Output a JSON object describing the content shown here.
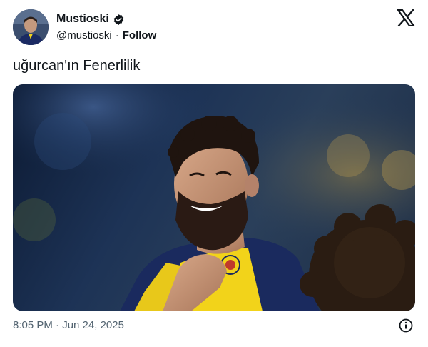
{
  "author": {
    "display_name": "Mustioski",
    "handle": "@mustioski",
    "separator": "·",
    "follow_label": "Follow"
  },
  "tweet": {
    "text": "uğurcan'ın Fenerlilik",
    "timestamp": "8:05 PM · Jun 24, 2025"
  },
  "icons": {
    "verified": "verified-badge-icon",
    "platform": "x-logo-icon",
    "info": "info-icon"
  },
  "colors": {
    "text": "#0f1419",
    "secondary": "#536471",
    "jersey_yellow": "#f2d31a",
    "jersey_navy": "#1a2a5e"
  }
}
